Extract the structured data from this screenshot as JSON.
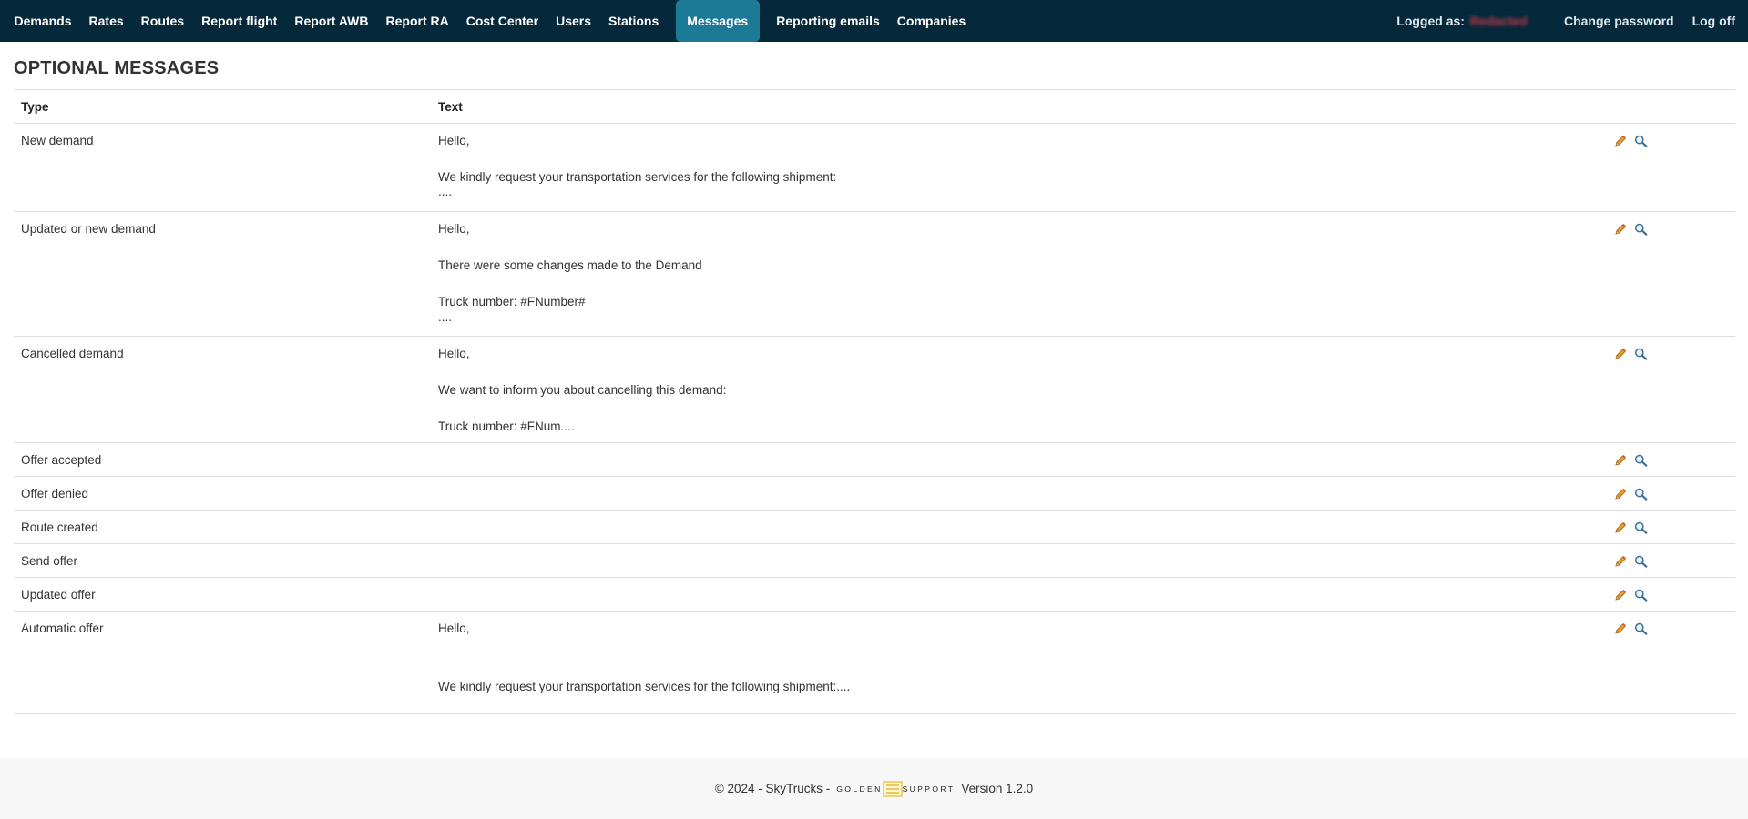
{
  "nav": {
    "items": [
      {
        "label": "Demands",
        "active": false
      },
      {
        "label": "Rates",
        "active": false
      },
      {
        "label": "Routes",
        "active": false
      },
      {
        "label": "Report flight",
        "active": false
      },
      {
        "label": "Report AWB",
        "active": false
      },
      {
        "label": "Report RA",
        "active": false
      },
      {
        "label": "Cost Center",
        "active": false
      },
      {
        "label": "Users",
        "active": false
      },
      {
        "label": "Stations",
        "active": false
      },
      {
        "label": "Messages",
        "active": true
      },
      {
        "label": "Reporting emails",
        "active": false
      },
      {
        "label": "Companies",
        "active": false
      }
    ],
    "logged_as_label": "Logged as:",
    "logged_user": "Redacted",
    "change_password": "Change password",
    "log_off": "Log off"
  },
  "page": {
    "title": "OPTIONAL MESSAGES"
  },
  "table": {
    "headers": {
      "type": "Type",
      "text": "Text"
    },
    "rows": [
      {
        "type": "New demand",
        "text": [
          "Hello,",
          "",
          "We kindly request your transportation services for the following shipment:",
          "...."
        ]
      },
      {
        "type": "Updated or new demand",
        "text": [
          "Hello,",
          "",
          "There were some changes made to the Demand",
          "",
          "Truck number: #FNumber#",
          "...."
        ]
      },
      {
        "type": "Cancelled demand",
        "text": [
          "Hello,",
          "",
          "We want to inform you about cancelling this demand:",
          "",
          "Truck number: #FNum...."
        ]
      },
      {
        "type": "Offer accepted",
        "text": []
      },
      {
        "type": "Offer denied",
        "text": []
      },
      {
        "type": "Route created",
        "text": []
      },
      {
        "type": "Send offer",
        "text": []
      },
      {
        "type": "Updated offer",
        "text": []
      },
      {
        "type": "Automatic offer",
        "text": [
          "Hello,",
          "",
          "",
          "We kindly request your transportation services for the following shipment:...."
        ]
      }
    ],
    "action_separator": "|",
    "icons": {
      "edit": "pencil-icon",
      "view": "magnifier-icon"
    }
  },
  "footer": {
    "text": "© 2024 - SkyTrucks -",
    "logo_left": "GOLDEN",
    "logo_right": "SUPPORT",
    "version": "Version 1.2.0"
  },
  "colors": {
    "navbar": "#05283a",
    "active_tab": "#1d7a96",
    "footer_bg": "#f7f7f7",
    "pencil": "#e8a227",
    "magnifier": "#3a6f96",
    "logo_accent": "#e8c547"
  }
}
